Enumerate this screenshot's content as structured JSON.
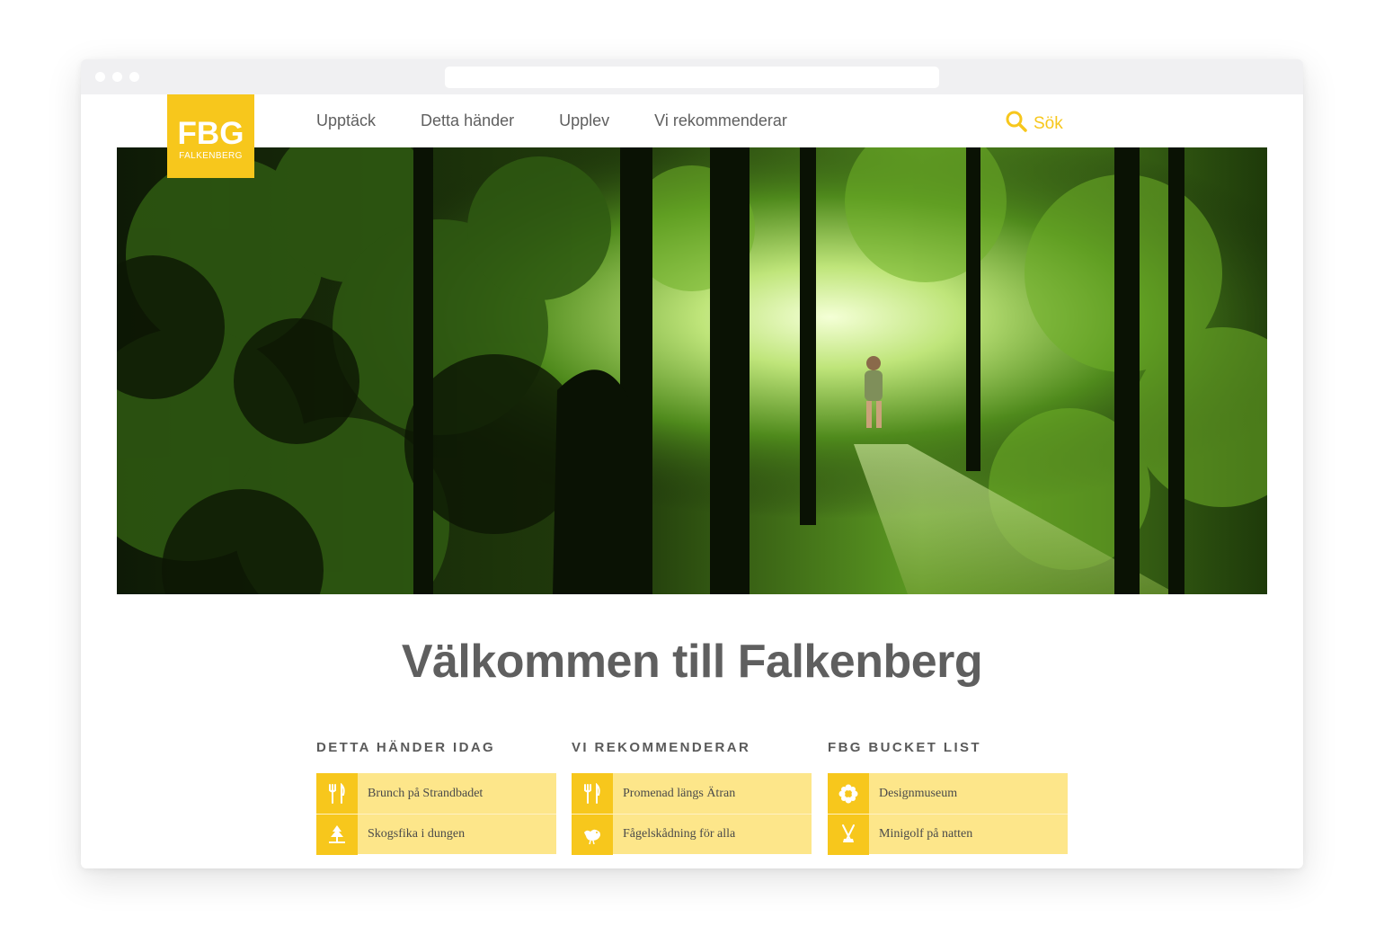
{
  "logo": {
    "mark": "FBG",
    "subtitle": "FALKENBERG"
  },
  "nav": {
    "items": [
      {
        "label": "Upptäck"
      },
      {
        "label": "Detta händer"
      },
      {
        "label": "Upplev"
      },
      {
        "label": "Vi rekommenderar"
      }
    ]
  },
  "search": {
    "label": "Sök",
    "icon": "search-icon"
  },
  "hero": {
    "description_icon": "forest-photo"
  },
  "main": {
    "title": "Välkommen till Falkenberg"
  },
  "sections": [
    {
      "heading": "DETTA HÄNDER IDAG",
      "items": [
        {
          "label": "Brunch på Strandbadet",
          "icon": "fork-knife-icon"
        },
        {
          "label": "Skogsfika i dungen",
          "icon": "tree-icon"
        }
      ]
    },
    {
      "heading": "VI REKOMMENDERAR",
      "items": [
        {
          "label": "Promenad längs Ätran",
          "icon": "fork-knife-icon"
        },
        {
          "label": "Fågelskådning för alla",
          "icon": "bird-icon"
        }
      ]
    },
    {
      "heading": "FBG BUCKET LIST",
      "items": [
        {
          "label": "Designmuseum",
          "icon": "flower-icon"
        },
        {
          "label": "Minigolf på natten",
          "icon": "golf-clubs-icon"
        }
      ]
    }
  ],
  "colors": {
    "accent": "#f7c71c",
    "row_bg": "#fde68a",
    "text": "#5f5f5f"
  }
}
